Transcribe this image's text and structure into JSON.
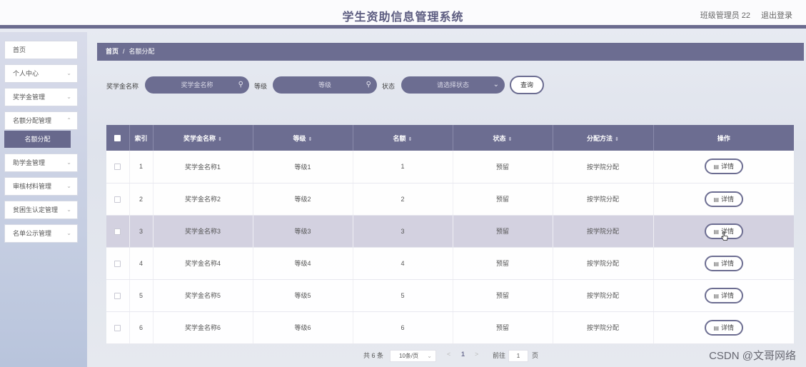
{
  "header": {
    "title": "学生资助信息管理系统",
    "user": "班级管理员 22",
    "logout": "退出登录"
  },
  "sidebar": {
    "items": [
      {
        "label": "首页"
      },
      {
        "label": "个人中心"
      },
      {
        "label": "奖学金管理"
      },
      {
        "label": "名额分配管理"
      },
      {
        "label": "名额分配"
      },
      {
        "label": "助学金管理"
      },
      {
        "label": "审核材料管理"
      },
      {
        "label": "贫困生认定管理"
      },
      {
        "label": "名单公示管理"
      }
    ]
  },
  "breadcrumb": {
    "home": "首页",
    "separator": "/",
    "current": "名额分配"
  },
  "filters": {
    "scholarship_label": "奖学金名称",
    "scholarship_placeholder": "奖学金名称",
    "level_label": "等级",
    "level_placeholder": "等级",
    "status_label": "状态",
    "status_placeholder": "请选择状态",
    "query_button": "查询"
  },
  "table": {
    "columns": [
      "索引",
      "奖学金名称",
      "等级",
      "名额",
      "状态",
      "分配方法",
      "操作"
    ],
    "sort_mark": "⇕",
    "rows": [
      {
        "index": "1",
        "name": "奖学金名称1",
        "level": "等级1",
        "quota": "1",
        "status": "预留",
        "method": "按学院分配",
        "action": "详情"
      },
      {
        "index": "2",
        "name": "奖学金名称2",
        "level": "等级2",
        "quota": "2",
        "status": "预留",
        "method": "按学院分配",
        "action": "详情"
      },
      {
        "index": "3",
        "name": "奖学金名称3",
        "level": "等级3",
        "quota": "3",
        "status": "预留",
        "method": "按学院分配",
        "action": "详情"
      },
      {
        "index": "4",
        "name": "奖学金名称4",
        "level": "等级4",
        "quota": "4",
        "status": "预留",
        "method": "按学院分配",
        "action": "详情"
      },
      {
        "index": "5",
        "name": "奖学金名称5",
        "level": "等级5",
        "quota": "5",
        "status": "预留",
        "method": "按学院分配",
        "action": "详情"
      },
      {
        "index": "6",
        "name": "奖学金名称6",
        "level": "等级6",
        "quota": "6",
        "status": "预留",
        "method": "按学院分配",
        "action": "详情"
      }
    ]
  },
  "pagination": {
    "total": "共 6 条",
    "page_size": "10条/页",
    "prev": "<",
    "current_page": "1",
    "next": ">",
    "goto_label": "前往",
    "goto_value": "1",
    "page_unit": "页"
  },
  "watermark": "CSDN @文哥网络",
  "colors": {
    "accent": "#6c6d91",
    "highlight_row": "#d3d1e0",
    "header_title": "#5c5c80"
  }
}
